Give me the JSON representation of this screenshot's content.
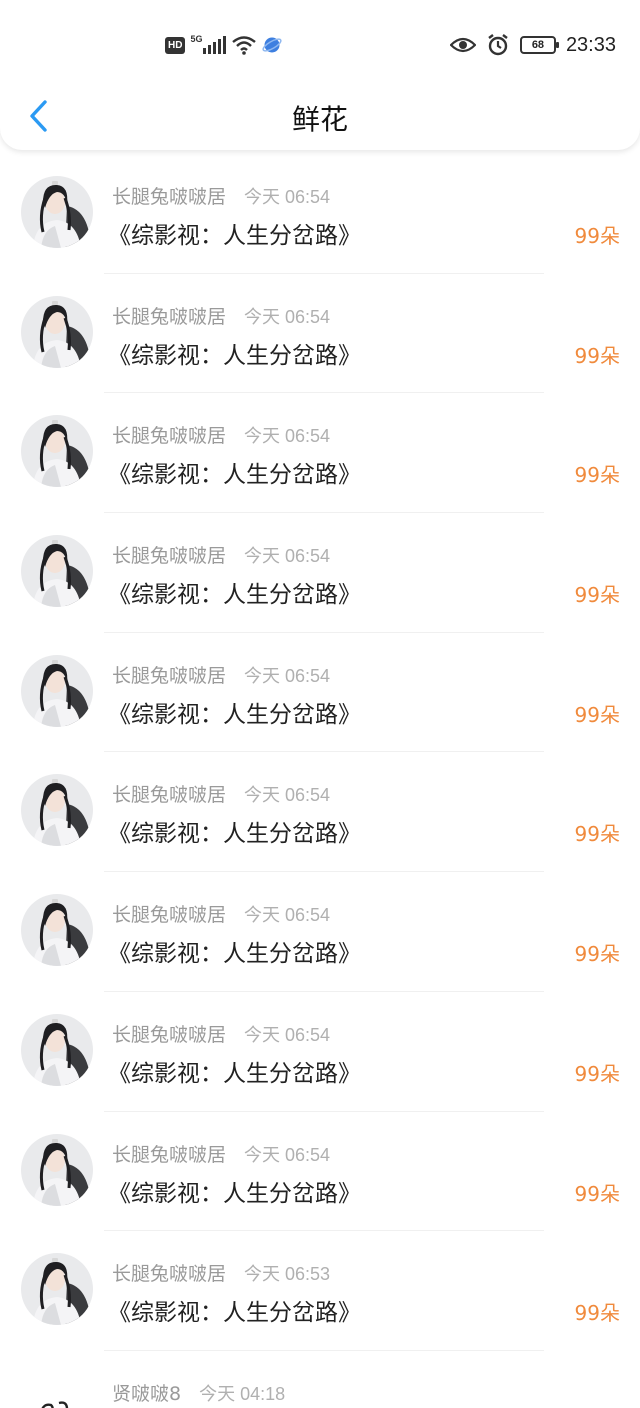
{
  "status_bar": {
    "hd": "HD",
    "network": "5G",
    "battery": "68",
    "time": "23:33",
    "icons": [
      "hd-icon",
      "signal-icon",
      "wifi-icon",
      "browser-icon",
      "eye-icon",
      "alarm-icon",
      "battery-icon"
    ]
  },
  "nav": {
    "back_icon": "chevron-left-icon",
    "title": "鲜花",
    "accent": "#2b9af3"
  },
  "colors": {
    "count": "#f08a3c",
    "username": "#9a9a9a",
    "time": "#b0b0b0"
  },
  "gifts": [
    {
      "user": "长腿兔啵啵居",
      "time": "今天 06:54",
      "book": "《综影视：人生分岔路》",
      "count": "99朵",
      "avatar": "portrait-avatar"
    },
    {
      "user": "长腿兔啵啵居",
      "time": "今天 06:54",
      "book": "《综影视：人生分岔路》",
      "count": "99朵",
      "avatar": "portrait-avatar"
    },
    {
      "user": "长腿兔啵啵居",
      "time": "今天 06:54",
      "book": "《综影视：人生分岔路》",
      "count": "99朵",
      "avatar": "portrait-avatar"
    },
    {
      "user": "长腿兔啵啵居",
      "time": "今天 06:54",
      "book": "《综影视：人生分岔路》",
      "count": "99朵",
      "avatar": "portrait-avatar"
    },
    {
      "user": "长腿兔啵啵居",
      "time": "今天 06:54",
      "book": "《综影视：人生分岔路》",
      "count": "99朵",
      "avatar": "portrait-avatar"
    },
    {
      "user": "长腿兔啵啵居",
      "time": "今天 06:54",
      "book": "《综影视：人生分岔路》",
      "count": "99朵",
      "avatar": "portrait-avatar"
    },
    {
      "user": "长腿兔啵啵居",
      "time": "今天 06:54",
      "book": "《综影视：人生分岔路》",
      "count": "99朵",
      "avatar": "portrait-avatar"
    },
    {
      "user": "长腿兔啵啵居",
      "time": "今天 06:54",
      "book": "《综影视：人生分岔路》",
      "count": "99朵",
      "avatar": "portrait-avatar"
    },
    {
      "user": "长腿兔啵啵居",
      "time": "今天 06:54",
      "book": "《综影视：人生分岔路》",
      "count": "99朵",
      "avatar": "portrait-avatar"
    },
    {
      "user": "长腿兔啵啵居",
      "time": "今天 06:53",
      "book": "《综影视：人生分岔路》",
      "count": "99朵",
      "avatar": "portrait-avatar"
    },
    {
      "user": "贤啵啵8",
      "time": "今天 04:18",
      "book": "",
      "count": "",
      "avatar": "sketch-avatar"
    }
  ]
}
